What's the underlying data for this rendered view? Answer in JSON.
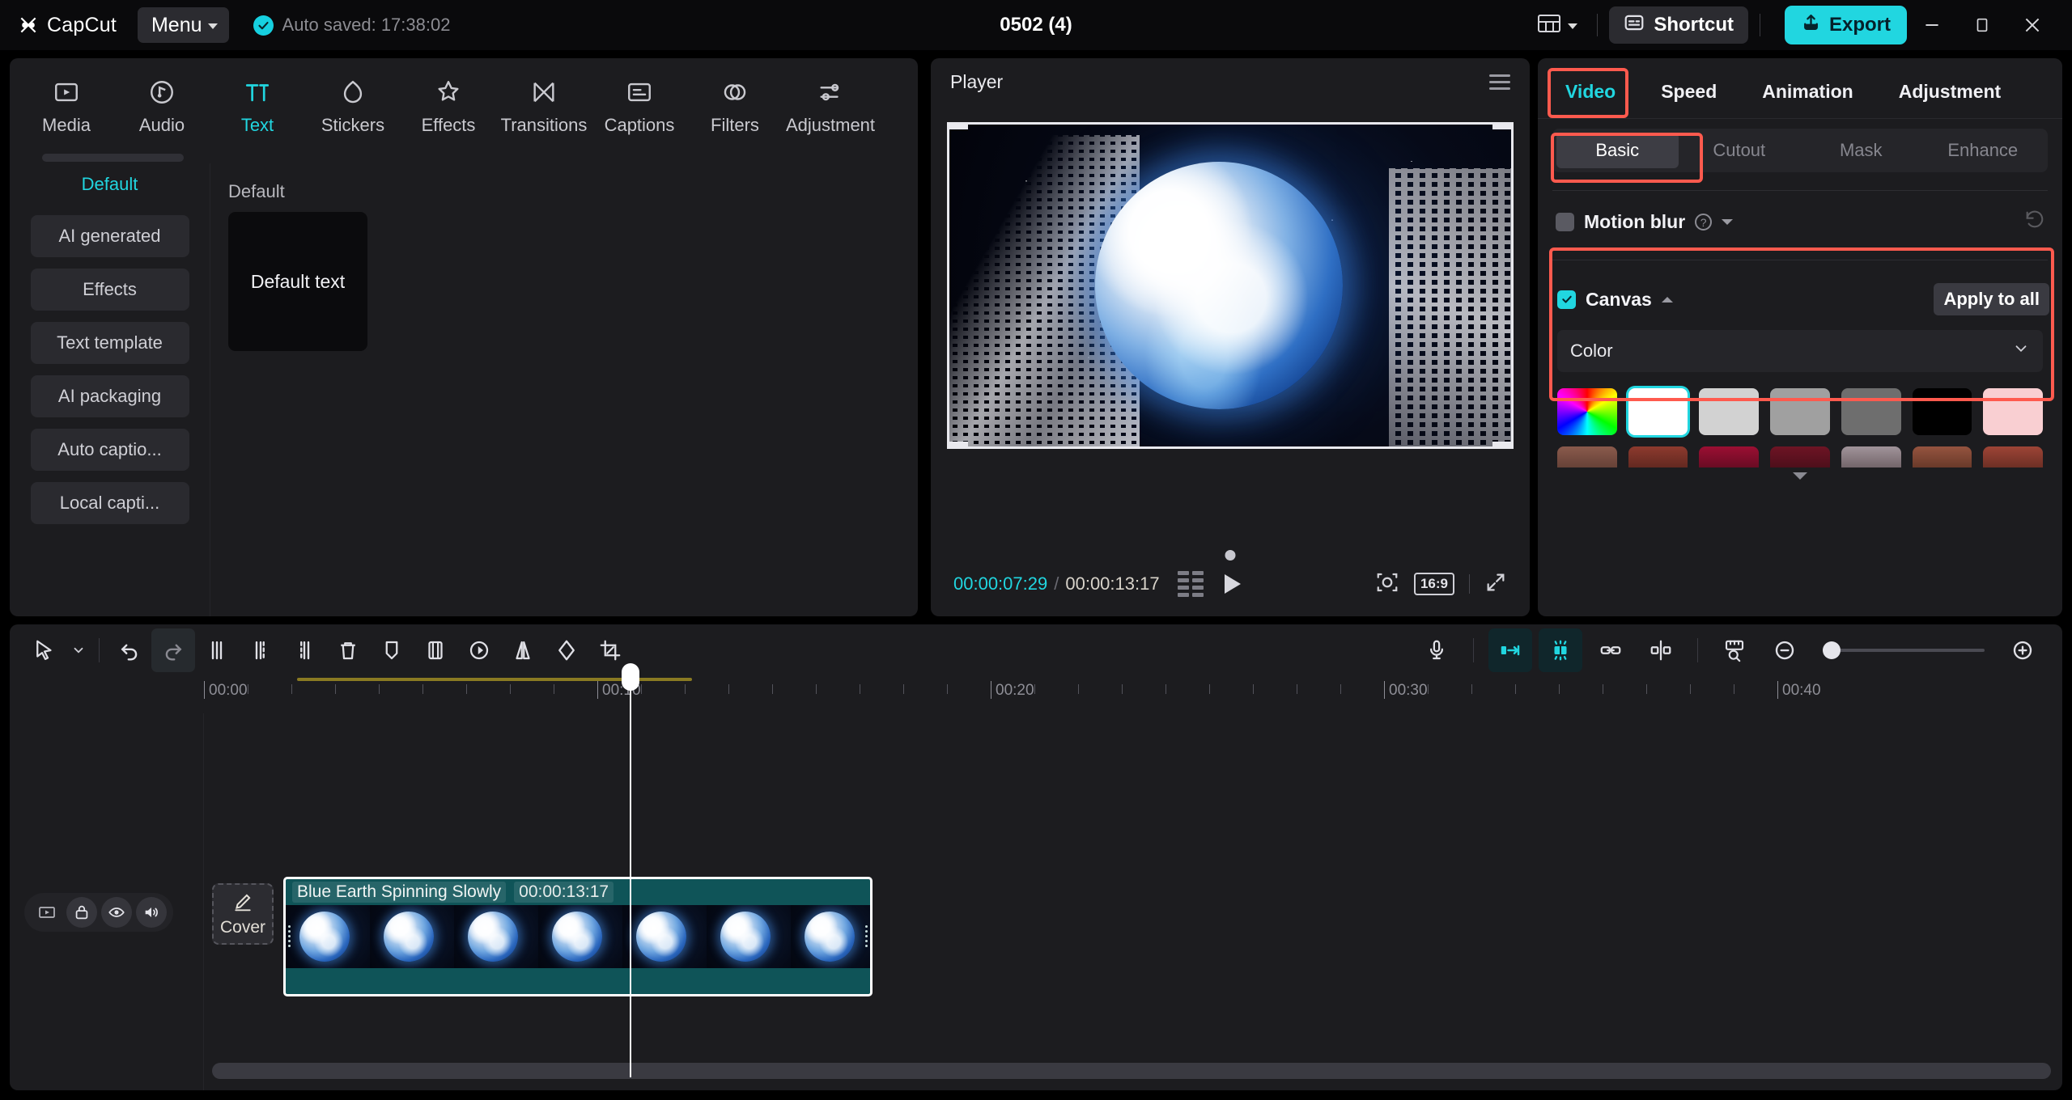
{
  "titlebar": {
    "brand": "CapCut",
    "menu_label": "Menu",
    "autosave_text": "Auto saved: 17:38:02",
    "project_title": "0502 (4)",
    "shortcut_label": "Shortcut",
    "export_label": "Export",
    "icons": {
      "logo": "capcut-logo-icon",
      "check": "autosave-check-icon",
      "layout": "layout-switch-icon",
      "shortcut": "keyboard-shortcut-icon",
      "export": "export-upload-icon",
      "minimize": "minimize-icon",
      "maximize": "maximize-icon",
      "close": "close-icon"
    }
  },
  "left_panel": {
    "tabs": [
      {
        "label": "Media",
        "icon": "media-icon",
        "active": false
      },
      {
        "label": "Audio",
        "icon": "audio-icon",
        "active": false
      },
      {
        "label": "Text",
        "icon": "text-icon",
        "active": true
      },
      {
        "label": "Stickers",
        "icon": "stickers-icon",
        "active": false
      },
      {
        "label": "Effects",
        "icon": "effects-icon",
        "active": false
      },
      {
        "label": "Transitions",
        "icon": "transitions-icon",
        "active": false
      },
      {
        "label": "Captions",
        "icon": "captions-icon",
        "active": false
      },
      {
        "label": "Filters",
        "icon": "filters-icon",
        "active": false
      },
      {
        "label": "Adjustment",
        "icon": "adjustment-icon",
        "active": false
      }
    ],
    "sidebar": [
      {
        "label": "Default",
        "active": true
      },
      {
        "label": "AI generated",
        "active": false
      },
      {
        "label": "Effects",
        "active": false
      },
      {
        "label": "Text template",
        "active": false
      },
      {
        "label": "AI packaging",
        "active": false
      },
      {
        "label": "Auto captio...",
        "active": false
      },
      {
        "label": "Local capti...",
        "active": false
      }
    ],
    "content": {
      "section_title": "Default",
      "card_label": "Default text"
    }
  },
  "player": {
    "title": "Player",
    "menu_icon": "player-menu-icon",
    "current_time": "00:00:07:29",
    "time_separator": "/",
    "total_time": "00:00:13:17",
    "icons": {
      "grid": "frame-grid-icon",
      "play": "play-icon",
      "zoom": "zoom-preview-icon",
      "fullscreen": "fullscreen-icon"
    },
    "aspect_ratio": "16:9"
  },
  "right_panel": {
    "tabs": [
      {
        "label": "Video",
        "active": true,
        "highlighted": true
      },
      {
        "label": "Speed",
        "active": false,
        "highlighted": false
      },
      {
        "label": "Animation",
        "active": false,
        "highlighted": false
      },
      {
        "label": "Adjustment",
        "active": false,
        "highlighted": false
      }
    ],
    "sub_tabs": [
      {
        "label": "Basic",
        "active": true,
        "highlighted": true
      },
      {
        "label": "Cutout",
        "active": false,
        "highlighted": false
      },
      {
        "label": "Mask",
        "active": false,
        "highlighted": false
      },
      {
        "label": "Enhance",
        "active": false,
        "highlighted": false
      }
    ],
    "motion_blur": {
      "label": "Motion blur",
      "enabled": false,
      "help_icon": "help-question-icon",
      "expand_icon": "chevron-down-icon",
      "reset_icon": "reset-icon"
    },
    "canvas": {
      "label": "Canvas",
      "checked": true,
      "collapse_icon": "chevron-up-icon",
      "apply_to_all_label": "Apply to all",
      "type_label": "Color",
      "type_caret": "chevron-down-icon",
      "swatches_row1": [
        {
          "name": "color-picker",
          "color": "rainbow",
          "selected": false
        },
        {
          "name": "white",
          "color": "#ffffff",
          "selected": true
        },
        {
          "name": "light-gray",
          "color": "#d2d2d2",
          "selected": false
        },
        {
          "name": "gray",
          "color": "#a0a0a0",
          "selected": false
        },
        {
          "name": "dark-gray",
          "color": "#6e6e6e",
          "selected": false
        },
        {
          "name": "black",
          "color": "#000000",
          "selected": false
        },
        {
          "name": "pink",
          "color": "#f9cfd2",
          "selected": false
        }
      ],
      "swatches_row2": [
        {
          "name": "brown-gradient-1",
          "color": "#8a5a4c"
        },
        {
          "name": "red-gradient-2",
          "color": "#8d3a2e"
        },
        {
          "name": "crimson-gradient-3",
          "color": "#9c0f33"
        },
        {
          "name": "maroon-gradient-4",
          "color": "#6e1424"
        },
        {
          "name": "mauve-gradient-5",
          "color": "#a1949a"
        },
        {
          "name": "rust-gradient-6",
          "color": "#95543f"
        },
        {
          "name": "brick-gradient-7",
          "color": "#9d4436"
        }
      ],
      "expand_more_icon": "chevron-down-icon"
    },
    "highlight_color": "#ff5a4e"
  },
  "timeline": {
    "toolbar_left": [
      {
        "name": "select-tool-icon",
        "active": false
      },
      {
        "name": "tool-dropdown-icon",
        "active": false
      },
      {
        "name": "undo-icon",
        "active": false
      },
      {
        "name": "redo-icon",
        "active": true
      },
      {
        "name": "split-icon",
        "active": false
      },
      {
        "name": "trim-left-icon",
        "active": false
      },
      {
        "name": "trim-right-icon",
        "active": false
      },
      {
        "name": "delete-icon",
        "active": false
      },
      {
        "name": "marker-icon",
        "active": false
      },
      {
        "name": "freeze-frame-icon",
        "active": false
      },
      {
        "name": "reverse-icon",
        "active": false
      },
      {
        "name": "mirror-icon",
        "active": false
      },
      {
        "name": "rotate-icon",
        "active": false
      },
      {
        "name": "crop-icon",
        "active": false
      }
    ],
    "toolbar_right": [
      {
        "name": "microphone-icon",
        "active": false
      },
      {
        "name": "snap-to-edge-icon",
        "active": true
      },
      {
        "name": "magnetic-snap-icon",
        "active": true
      },
      {
        "name": "link-clips-icon",
        "active": false
      },
      {
        "name": "split-view-icon",
        "active": false
      },
      {
        "name": "ruler-icon",
        "active": false
      },
      {
        "name": "zoom-out-icon",
        "active": false
      },
      {
        "name": "zoom-in-icon",
        "active": false
      }
    ],
    "ruler_labels": [
      "00:00",
      "00:10",
      "00:20",
      "00:30",
      "00:40"
    ],
    "track_controls": [
      {
        "name": "track-thumbnail-icon"
      },
      {
        "name": "lock-icon"
      },
      {
        "name": "eye-visibility-icon"
      },
      {
        "name": "speaker-volume-icon"
      }
    ],
    "cover_button": {
      "label": "Cover",
      "icon": "pencil-edit-icon"
    },
    "clip": {
      "name": "Blue Earth Spinning Slowly",
      "duration": "00:00:13:17",
      "selected": true,
      "thumbnail_count": 7
    }
  }
}
